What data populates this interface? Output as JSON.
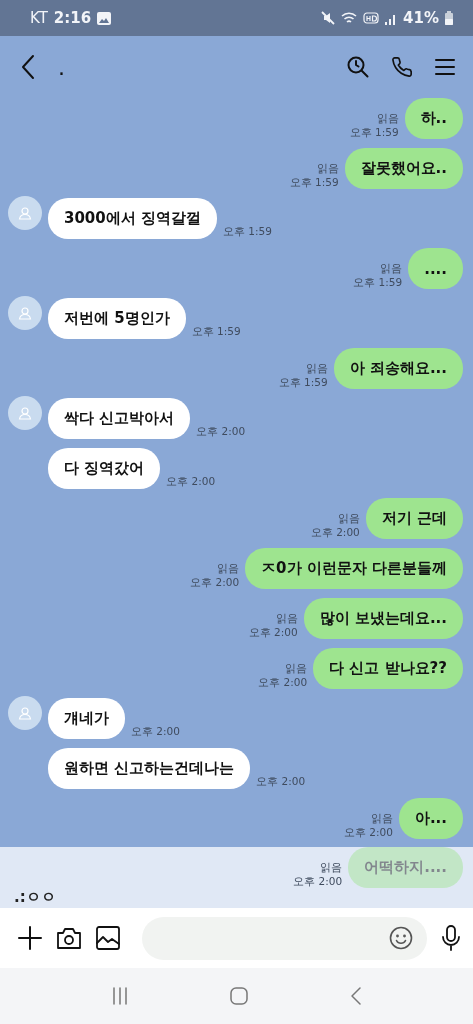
{
  "status_bar": {
    "carrier": "KT",
    "time": "2:16",
    "battery": "41%"
  },
  "header": {
    "title": "."
  },
  "messages": [
    {
      "kind": "sent",
      "text": "하..",
      "read": "읽음",
      "time": "오후 1:59"
    },
    {
      "kind": "sent",
      "text": "잘못했어요..",
      "read": "읽음",
      "time": "오후 1:59"
    },
    {
      "kind": "received",
      "avatar": true,
      "text": "3000에서 징역갈껄",
      "time": "오후 1:59"
    },
    {
      "kind": "sent",
      "text": "....",
      "read": "읽음",
      "time": "오후 1:59"
    },
    {
      "kind": "received",
      "avatar": true,
      "text": "저번에 5명인가",
      "time": "오후 1:59"
    },
    {
      "kind": "sent",
      "text": "아 죄송해요...",
      "read": "읽음",
      "time": "오후 1:59"
    },
    {
      "kind": "received",
      "avatar": true,
      "text": "싹다 신고박아서",
      "time": "오후 2:00"
    },
    {
      "kind": "received",
      "avatar": false,
      "text": "다 징역갔어",
      "time": "오후 2:00"
    },
    {
      "kind": "sent",
      "text": "저기 근데",
      "read": "읽음",
      "time": "오후 2:00"
    },
    {
      "kind": "sent",
      "text": "ㅈ0가 이런문자 다른분들께",
      "read": "읽음",
      "time": "오후 2:00"
    },
    {
      "kind": "sent",
      "text": "많이 보냈는데요...",
      "read": "읽음",
      "time": "오후 2:00"
    },
    {
      "kind": "sent",
      "text": "다 신고 받나요??",
      "read": "읽음",
      "time": "오후 2:00"
    },
    {
      "kind": "received",
      "avatar": true,
      "text": "걔네가",
      "time": "오후 2:00"
    },
    {
      "kind": "received",
      "avatar": false,
      "text": "원하면 신고하는건데나는",
      "time": "오후 2:00"
    },
    {
      "kind": "sent",
      "text": "아...",
      "read": "읽음",
      "time": "오후 2:00"
    },
    {
      "kind": "sent",
      "text": "어떡하지....",
      "read": "읽음",
      "time": "오후 2:00"
    }
  ],
  "new_message_preview": {
    "text": ".:ㅇㅇ"
  }
}
